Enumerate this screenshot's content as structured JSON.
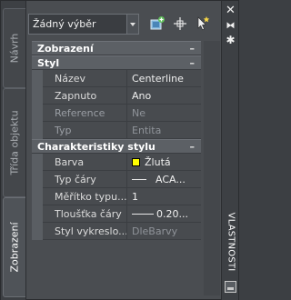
{
  "tabs": [
    {
      "label": "Návrh"
    },
    {
      "label": "Třída objektu"
    },
    {
      "label": "Zobrazení"
    }
  ],
  "toolbar": {
    "selection": "Žádný výběr"
  },
  "palette_title": "VLASTNOSTI",
  "categories": [
    {
      "label": "Zobrazení",
      "toggle": "–"
    },
    {
      "label": "Styl",
      "toggle": "–"
    },
    {
      "label": "Charakteristiky stylu",
      "toggle": "–"
    }
  ],
  "style_props": [
    {
      "name": "Název",
      "value": "Centerline"
    },
    {
      "name": "Zapnuto",
      "value": "Ano"
    },
    {
      "name": "Reference",
      "value": "Ne"
    },
    {
      "name": "Typ",
      "value": "Entita"
    }
  ],
  "char_props": [
    {
      "name": "Barva",
      "value": "Žlutá"
    },
    {
      "name": "Typ čáry",
      "value": "ACA..."
    },
    {
      "name": "Měřítko typu...",
      "value": "1"
    },
    {
      "name": "Tloušťka čáry",
      "value": "0.20..."
    },
    {
      "name": "Styl vykreslo...",
      "value": "DleBarvy"
    }
  ],
  "colors": {
    "accent_yellow": "#ffff00",
    "panel": "#4a4d51"
  },
  "icons": [
    "quick-select-icon",
    "pick-objects-icon",
    "toggle-pickadd-icon",
    "close-icon",
    "autohide-icon",
    "properties-menu-icon"
  ]
}
